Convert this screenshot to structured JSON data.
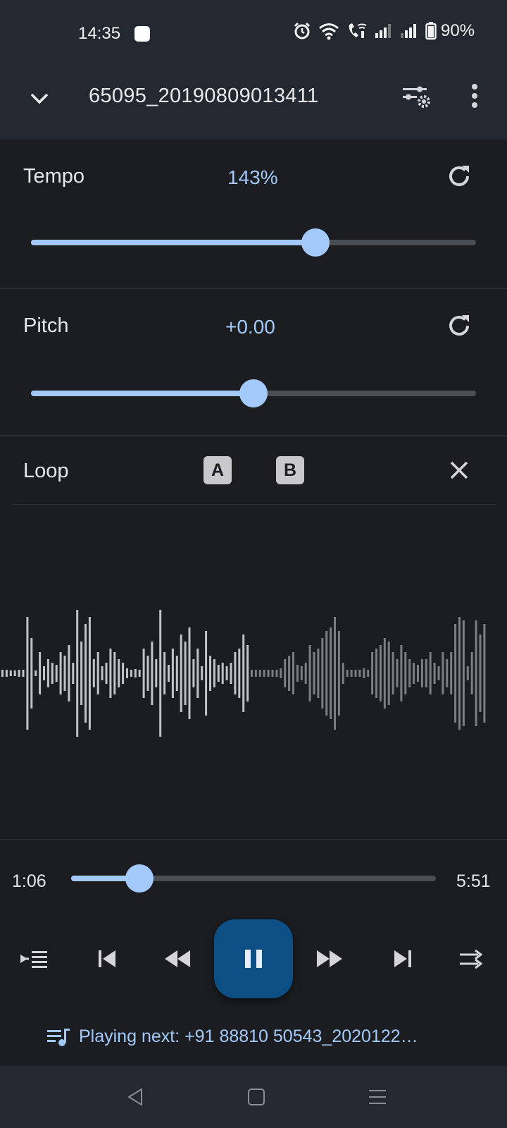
{
  "status_bar": {
    "time": "14:35",
    "battery_text": "90%",
    "icons": [
      "paytm-app-icon",
      "alarm-icon",
      "wifi-icon",
      "wifi-call-icon",
      "signal-icon",
      "signal-icon",
      "battery-icon"
    ]
  },
  "app_bar": {
    "title": "65095_20190809013411"
  },
  "tempo": {
    "label": "Tempo",
    "value": "143%",
    "level": 0.64
  },
  "pitch": {
    "label": "Pitch",
    "value": "+0.00",
    "level": 0.5
  },
  "loop": {
    "label": "Loop",
    "a_label": "A",
    "b_label": "B"
  },
  "player": {
    "elapsed": "1:06",
    "duration": "5:51",
    "progress": 0.188,
    "playing_next": "Playing next: +91 88810 50543_2020122…"
  },
  "colors": {
    "accent": "#a3c9fa",
    "play_button": "#0c4f85",
    "background": "#1c1d20",
    "bar": "#242830"
  }
}
